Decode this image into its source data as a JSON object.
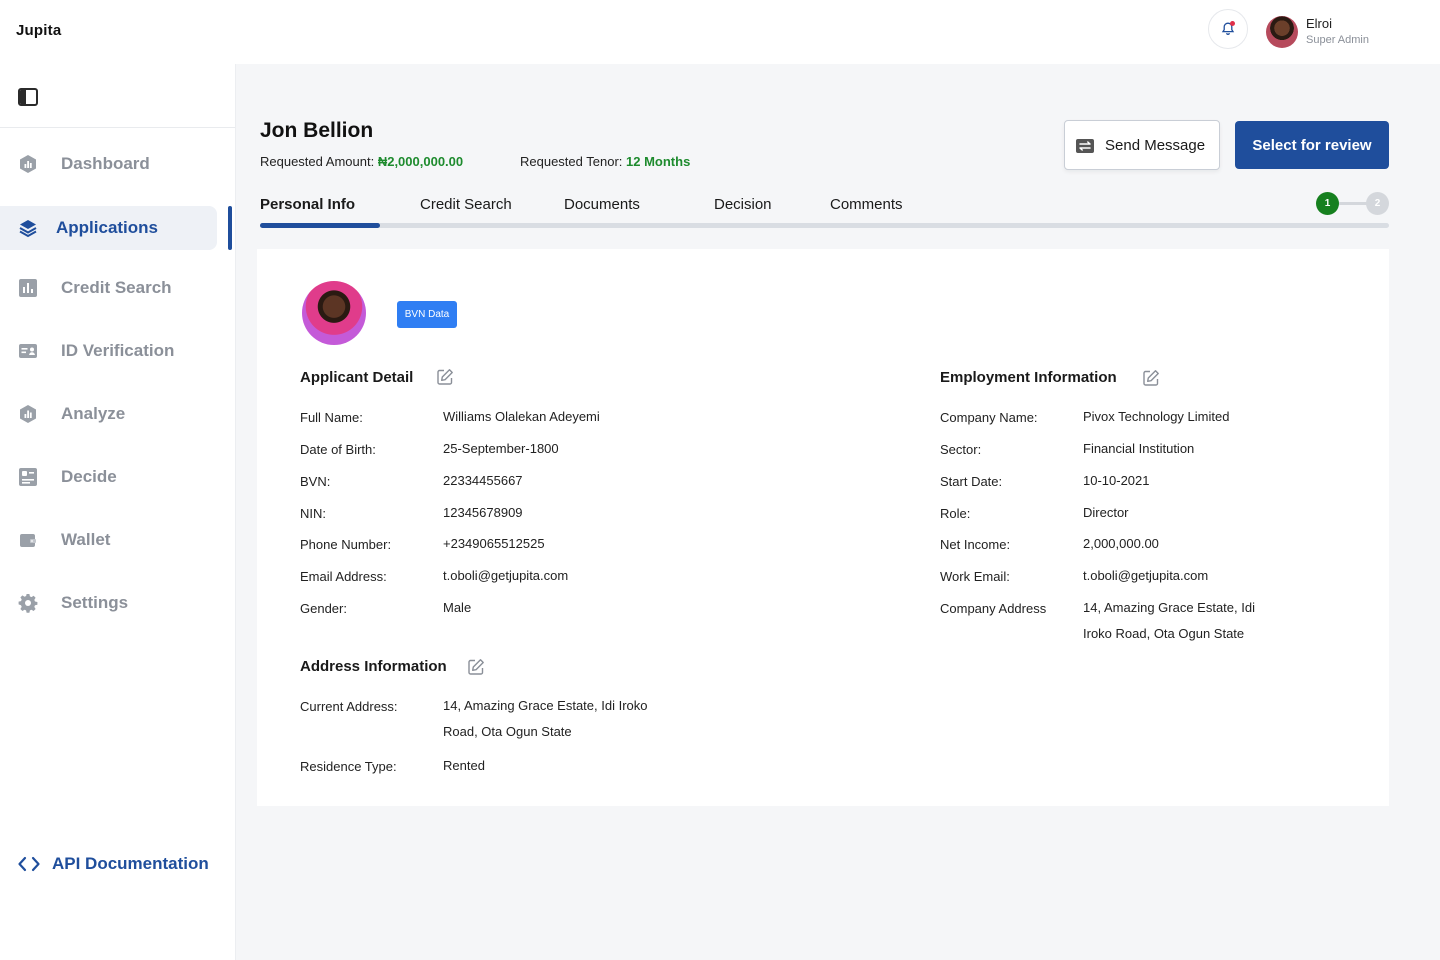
{
  "app": {
    "brand": "Jupita"
  },
  "user": {
    "name": "Elroi",
    "role": "Super Admin"
  },
  "sidebar": {
    "items": [
      {
        "label": "Dashboard",
        "icon": "dashboard-icon"
      },
      {
        "label": "Applications",
        "icon": "layers-icon",
        "active": true
      },
      {
        "label": "Credit Search",
        "icon": "bar-chart-icon"
      },
      {
        "label": "ID Verification",
        "icon": "id-card-icon"
      },
      {
        "label": "Analyze",
        "icon": "analyze-icon"
      },
      {
        "label": "Decide",
        "icon": "decide-icon"
      },
      {
        "label": "Wallet",
        "icon": "wallet-icon"
      },
      {
        "label": "Settings",
        "icon": "gear-icon"
      }
    ],
    "api_doc": "API Documentation"
  },
  "applicant": {
    "name": "Jon Bellion",
    "amount_label": "Requested Amount:",
    "amount_value": "₦2,000,000.00",
    "tenor_label": "Requested Tenor:",
    "tenor_value": "12 Months"
  },
  "actions": {
    "send_message": "Send Message",
    "select_review": "Select for review"
  },
  "tabs": [
    "Personal Info",
    "Credit Search",
    "Documents",
    "Decision",
    "Comments"
  ],
  "steps": [
    "1",
    "2"
  ],
  "badge": "BVN Data",
  "applicant_detail": {
    "title": "Applicant Detail",
    "fields": [
      {
        "label": "Full Name:",
        "value": "Williams Olalekan Adeyemi"
      },
      {
        "label": "Date of Birth:",
        "value": "25-September-1800"
      },
      {
        "label": "BVN:",
        "value": "22334455667"
      },
      {
        "label": "NIN:",
        "value": "12345678909"
      },
      {
        "label": "Phone Number:",
        "value": "+2349065512525"
      },
      {
        "label": "Email Address:",
        "value": "t.oboli@getjupita.com"
      },
      {
        "label": "Gender:",
        "value": "Male"
      }
    ]
  },
  "address_info": {
    "title": "Address Information",
    "fields": [
      {
        "label": "Current Address:",
        "value": "14, Amazing Grace Estate, Idi Iroko",
        "value2": "Road, Ota Ogun State"
      },
      {
        "label": "Residence Type:",
        "value": "Rented"
      }
    ]
  },
  "employment_info": {
    "title": "Employment Information",
    "fields": [
      {
        "label": "Company Name:",
        "value": "Pivox Technology Limited"
      },
      {
        "label": "Sector:",
        "value": "Financial Institution"
      },
      {
        "label": "Start Date:",
        "value": "10-10-2021"
      },
      {
        "label": "Role:",
        "value": "Director"
      },
      {
        "label": "Net Income:",
        "value": "2,000,000.00"
      },
      {
        "label": "Work Email:",
        "value": "t.oboli@getjupita.com"
      },
      {
        "label": "Company Address",
        "value": "14, Amazing Grace Estate, Idi",
        "value2": "Iroko Road, Ota Ogun State"
      }
    ]
  },
  "colors": {
    "primary": "#1f4e9c",
    "success": "#1e8b2e",
    "badge": "#2f7ef3"
  }
}
